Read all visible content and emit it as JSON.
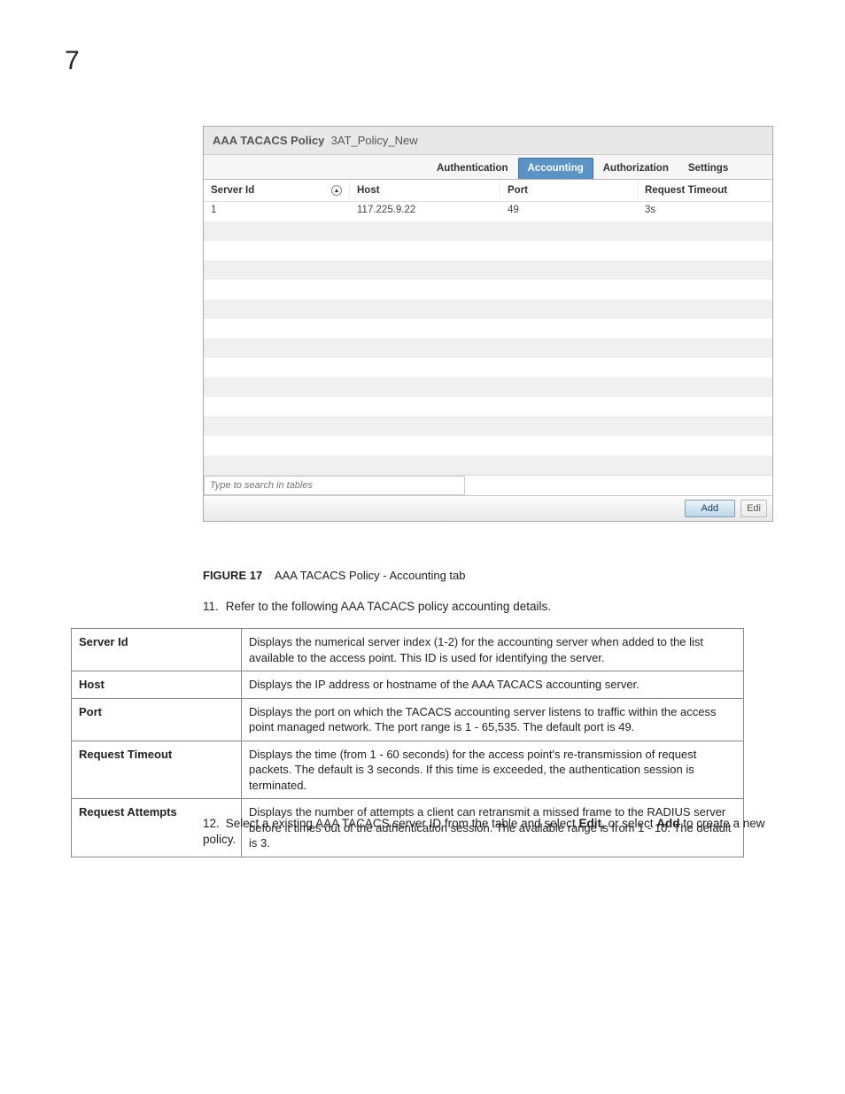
{
  "page_number": "7",
  "panel": {
    "title_prefix": "AAA TACACS Policy",
    "title_name": "3AT_Policy_New",
    "tabs": [
      "Authentication",
      "Accounting",
      "Authorization",
      "Settings"
    ],
    "active_tab_index": 1,
    "columns": [
      "Server Id",
      "Host",
      "Port",
      "Request Timeout"
    ],
    "rows": [
      {
        "server_id": "1",
        "host": "117.225.9.22",
        "port": "49",
        "timeout": "3s"
      }
    ],
    "blank_row_count": 13,
    "search_placeholder": "Type to search in tables",
    "buttons": {
      "add": "Add",
      "edit": "Edi"
    }
  },
  "figure": {
    "label": "FIGURE 17",
    "caption": "AAA TACACS Policy - Accounting tab"
  },
  "step11": {
    "num": "11.",
    "text": "Refer to the following AAA TACACS policy accounting details."
  },
  "defs": [
    {
      "term": "Server Id",
      "desc": "Displays the numerical server index (1-2) for the accounting server when added to the list available to the access point. This ID is used for identifying the server."
    },
    {
      "term": "Host",
      "desc": "Displays the IP address or hostname of the AAA TACACS accounting server."
    },
    {
      "term": "Port",
      "desc": "Displays the port on which the TACACS accounting server listens to traffic within the access point managed network. The port range is 1 - 65,535. The default port is 49."
    },
    {
      "term": "Request Timeout",
      "desc": "Displays the time (from 1 - 60 seconds) for the access point's re-transmission of request packets. The default is 3 seconds. If this time is exceeded, the authentication session is terminated."
    },
    {
      "term": "Request Attempts",
      "desc": "Displays the number of attempts a client can retransmit a missed frame to the RADIUS server before it times out of the authentication session. The available range is from 1 - 10. The default is 3."
    }
  ],
  "step12": {
    "num": "12.",
    "pre": "Select a existing AAA TACACS server ID from the table and select ",
    "edit": "Edit,",
    "mid": " or select ",
    "add": "Add",
    "post": " to create a new policy."
  }
}
